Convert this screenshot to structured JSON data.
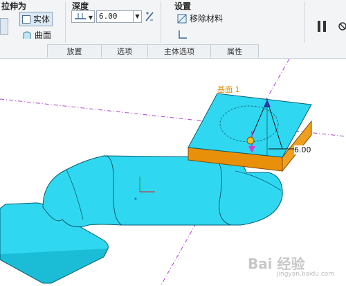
{
  "ribbon": {
    "extrude_as": {
      "title": "拉伸为",
      "solid_label": "实体",
      "surface_label": "曲面"
    },
    "depth": {
      "title": "深度",
      "value": "6.00"
    },
    "settings": {
      "title": "设置",
      "remove_material_label": "移除材料"
    },
    "tabs": [
      "放置",
      "选项",
      "主体选项",
      "属性"
    ]
  },
  "viewport": {
    "plane_label": "基面 1",
    "dimension_value": "6.00",
    "watermark": "Bai 经验",
    "watermark_sub": "jingyan.baidu.com"
  },
  "colors": {
    "model_fill": "#2fd8f0",
    "model_edge": "#0a5a70",
    "extrude_side": "#e8900a",
    "datum_line": "#b040d0",
    "plane_label": "#e08a00"
  }
}
